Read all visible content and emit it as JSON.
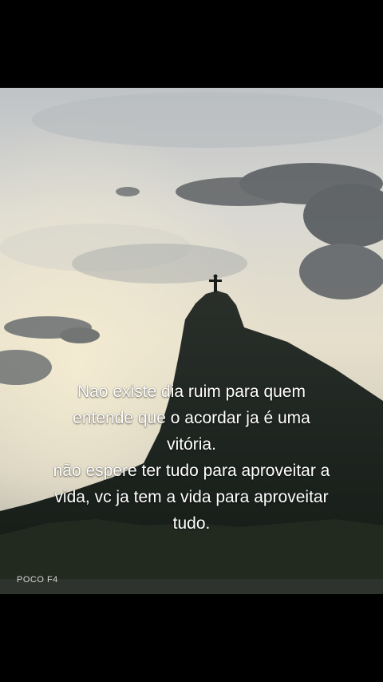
{
  "caption": {
    "lines": [
      "Nao existe dia ruim para quem",
      "entende que o acordar ja é uma",
      "vitória.",
      "não espere ter tudo para aproveitar a",
      "vida, vc ja tem a vida para aproveitar",
      "tudo."
    ]
  },
  "watermark": "POCO F4",
  "colors": {
    "sky_top": "#c9cbcd",
    "sky_mid": "#e2dccd",
    "sky_horizon": "#d8d2bd",
    "mountain": "#1b2018",
    "vegetation": "#2a3324"
  }
}
